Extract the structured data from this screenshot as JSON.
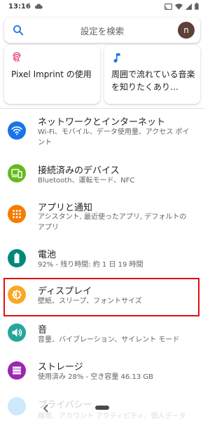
{
  "status_bar": {
    "time": "13:16",
    "icons_left": [
      "cloud-icon"
    ],
    "icons_right": [
      "cast-icon",
      "wifi-icon",
      "signal-icon",
      "battery-icon"
    ]
  },
  "search": {
    "placeholder": "設定を検索",
    "icon": "search-icon",
    "avatar_letter": "n",
    "avatar_color": "#5d4037"
  },
  "suggestions": [
    {
      "label": "Pixel Imprint の使用",
      "icon": "fingerprint-icon"
    },
    {
      "label": "周囲で流れている音楽を知りたくあり…",
      "icon": "music-note-icon"
    }
  ],
  "settings": [
    {
      "title": "ネットワークとインターネット",
      "subtitle": "Wi-Fi、モバイル、データ使用量、アクセス ポイント",
      "icon": "wifi-icon",
      "color": "#1a73e8"
    },
    {
      "title": "接続済みのデバイス",
      "subtitle": "Bluetooth、運転モード、NFC",
      "icon": "devices-icon",
      "color": "#66bb1a"
    },
    {
      "title": "アプリと通知",
      "subtitle": "アシスタント, 最近使ったアプリ, デフォルトのアプリ",
      "icon": "apps-icon",
      "color": "#f57c00"
    },
    {
      "title": "電池",
      "subtitle": "92% - 残り時間: 約 1 日 19 時間",
      "icon": "battery-icon",
      "color": "#00897b"
    },
    {
      "title": "ディスプレイ",
      "subtitle": "壁紙、スリープ、フォントサイズ",
      "icon": "brightness-icon",
      "color": "#f9a825"
    },
    {
      "title": "音",
      "subtitle": "音量、バイブレーション、サイレント モード",
      "icon": "volume-icon",
      "color": "#26a69a"
    },
    {
      "title": "ストレージ",
      "subtitle": "使用済み 28% - 空き容量 46.13 GB",
      "icon": "storage-icon",
      "color": "#9c27b0"
    },
    {
      "title": "プライバシー",
      "subtitle": "権限、アカウント アクティビティ、個人データ",
      "icon": "privacy-icon",
      "color": "#2196f3"
    }
  ],
  "highlight_color": "#e01010"
}
